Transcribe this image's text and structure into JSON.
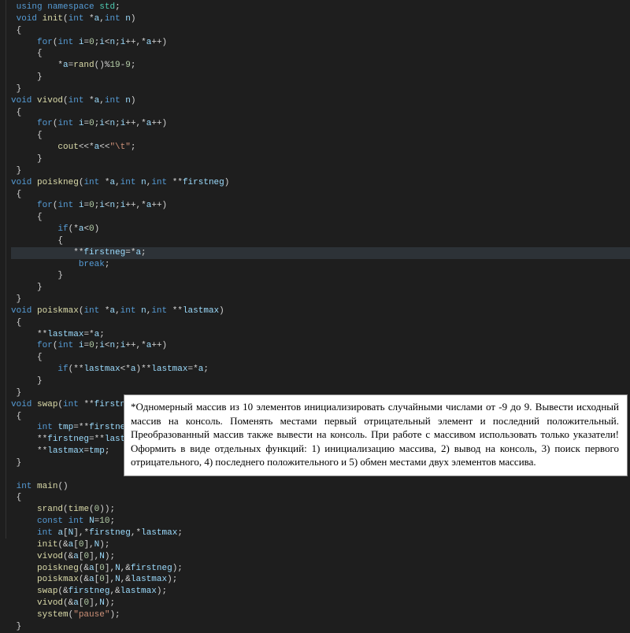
{
  "editor": {
    "lines": [
      {
        "t": " using namespace std;",
        "cls": ""
      },
      {
        "t": " void init(int *a,int n)",
        "cls": ""
      },
      {
        "t": " {",
        "cls": ""
      },
      {
        "t": "     for(int i=0;i<n;i++,*a++)",
        "cls": ""
      },
      {
        "t": "     {",
        "cls": ""
      },
      {
        "t": "         *a=rand()%19-9;",
        "cls": ""
      },
      {
        "t": "     }",
        "cls": ""
      },
      {
        "t": " }",
        "cls": ""
      },
      {
        "t": "void vivod(int *a,int n)",
        "cls": ""
      },
      {
        "t": " {",
        "cls": ""
      },
      {
        "t": "     for(int i=0;i<n;i++,*a++)",
        "cls": ""
      },
      {
        "t": "     {",
        "cls": ""
      },
      {
        "t": "         cout<<*a<<\"\\t\";",
        "cls": ""
      },
      {
        "t": "     }",
        "cls": ""
      },
      {
        "t": " }",
        "cls": ""
      },
      {
        "t": "void poiskneg(int *a,int n,int **firstneg)",
        "cls": ""
      },
      {
        "t": " {",
        "cls": ""
      },
      {
        "t": "     for(int i=0;i<n;i++,*a++)",
        "cls": ""
      },
      {
        "t": "     {",
        "cls": ""
      },
      {
        "t": "         if(*a<0)",
        "cls": ""
      },
      {
        "t": "         {",
        "cls": ""
      },
      {
        "t": "            **firstneg=*a;",
        "cls": "hl"
      },
      {
        "t": "             break;",
        "cls": ""
      },
      {
        "t": "         }",
        "cls": ""
      },
      {
        "t": "     }",
        "cls": ""
      },
      {
        "t": " }",
        "cls": ""
      },
      {
        "t": "void poiskmax(int *a,int n,int **lastmax)",
        "cls": ""
      },
      {
        "t": " {",
        "cls": ""
      },
      {
        "t": "     **lastmax=*a;",
        "cls": ""
      },
      {
        "t": "     for(int i=0;i<n;i++,*a++)",
        "cls": ""
      },
      {
        "t": "     {",
        "cls": ""
      },
      {
        "t": "         if(**lastmax<*a)**lastmax=*a;",
        "cls": ""
      },
      {
        "t": "     }",
        "cls": ""
      },
      {
        "t": " }",
        "cls": ""
      },
      {
        "t": "void swap(int **firstneg,int **lastmax)",
        "cls": ""
      },
      {
        "t": " {",
        "cls": ""
      },
      {
        "t": "     int tmp=**firstneg;",
        "cls": ""
      },
      {
        "t": "     **firstneg=**lastmax;",
        "cls": ""
      },
      {
        "t": "     **lastmax=tmp;",
        "cls": ""
      },
      {
        "t": " }",
        "cls": ""
      },
      {
        "t": "",
        "cls": ""
      },
      {
        "t": " int main()",
        "cls": ""
      },
      {
        "t": " {",
        "cls": ""
      },
      {
        "t": "     srand(time(0));",
        "cls": ""
      },
      {
        "t": "     const int N=10;",
        "cls": ""
      },
      {
        "t": "     int a[N],*firstneg,*lastmax;",
        "cls": ""
      },
      {
        "t": "     init(&a[0],N);",
        "cls": ""
      },
      {
        "t": "     vivod(&a[0],N);",
        "cls": ""
      },
      {
        "t": "     poiskneg(&a[0],N,&firstneg);",
        "cls": ""
      },
      {
        "t": "     poiskmax(&a[0],N,&lastmax);",
        "cls": ""
      },
      {
        "t": "     swap(&firstneg,&lastmax);",
        "cls": ""
      },
      {
        "t": "     vivod(&a[0],N);",
        "cls": ""
      },
      {
        "t": "     system(\"pause\");",
        "cls": ""
      },
      {
        "t": " }",
        "cls": ""
      }
    ]
  },
  "overlay": {
    "text": "*Одномерный массив из 10 элементов инициализировать случайными числами от   -9 до 9. Вывести исходный массив на консоль. Поменять местами первый отрицательный элемент и последний положительный. Преобразованный массив также вывести на консоль. При работе с массивом использовать только указатели! Оформить в виде отдельных функций: 1) инициализацию массива, 2) вывод на консоль, 3) поиск первого отрицательного, 4) последнего положительного и 5) обмен местами двух элементов массива."
  }
}
